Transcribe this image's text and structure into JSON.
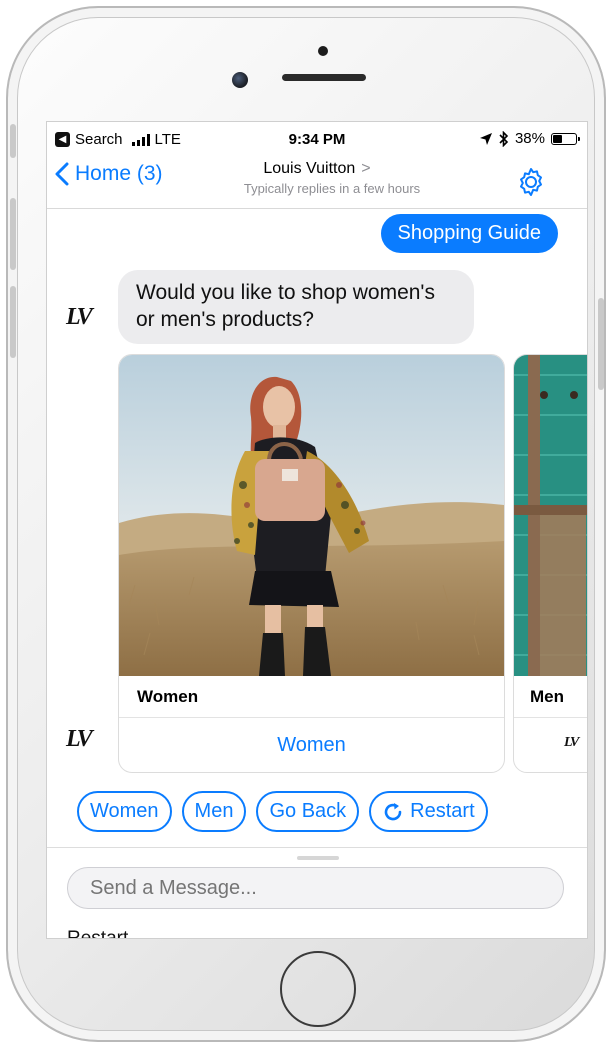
{
  "status_bar": {
    "back_app": "Search",
    "network": "LTE",
    "time": "9:34 PM",
    "battery": "38%",
    "battery_level": 0.38
  },
  "nav": {
    "back_label": "Home (3)",
    "title": "Louis Vuitton",
    "title_chevron": ">",
    "subtitle": "Typically replies in a few hours"
  },
  "messages": {
    "user": "Shopping Guide",
    "bot": "Would you like to shop women's or men's products?"
  },
  "brand": {
    "logo_text": "LV"
  },
  "carousel": [
    {
      "title": "Women",
      "button": "Women"
    },
    {
      "title": "Men"
    }
  ],
  "quick_replies": [
    "Women",
    "Men",
    "Go Back",
    "Restart"
  ],
  "composer": {
    "placeholder": "Send a Message...",
    "menu_peek": "Restart"
  },
  "colors": {
    "accent": "#0a7cff",
    "bot_bubble": "#ececee",
    "secondary_text": "#8e8e93"
  }
}
